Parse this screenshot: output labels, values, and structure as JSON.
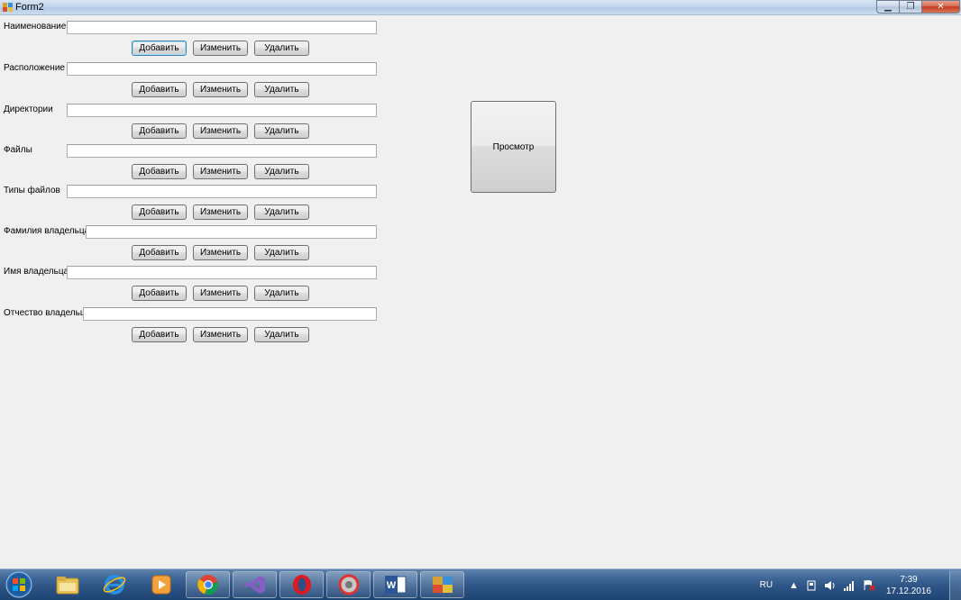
{
  "window": {
    "title": "Form2",
    "min_glyph": "▁",
    "max_glyph": "❐",
    "close_glyph": "✕"
  },
  "form": {
    "rows": [
      {
        "label": "Наименование",
        "value": "",
        "add": "Добавить",
        "edit": "Изменить",
        "delete": "Удалить"
      },
      {
        "label": "Расположение",
        "value": "",
        "add": "Добавить",
        "edit": "Изменить",
        "delete": "Удалить"
      },
      {
        "label": "Директории",
        "value": "",
        "add": "Добавить",
        "edit": "Изменить",
        "delete": "Удалить"
      },
      {
        "label": "Файлы",
        "value": "",
        "add": "Добавить",
        "edit": "Изменить",
        "delete": "Удалить"
      },
      {
        "label": "Типы файлов",
        "value": "",
        "add": "Добавить",
        "edit": "Изменить",
        "delete": "Удалить"
      },
      {
        "label": "Фамилия владельца",
        "value": "",
        "add": "Добавить",
        "edit": "Изменить",
        "delete": "Удалить"
      },
      {
        "label": "Имя владельца",
        "value": "",
        "add": "Добавить",
        "edit": "Изменить",
        "delete": "Удалить"
      },
      {
        "label": "Отчество владельца",
        "value": "",
        "add": "Добавить",
        "edit": "Изменить",
        "delete": "Удалить"
      }
    ],
    "view_button": "Просмотр"
  },
  "taskbar": {
    "apps": [
      {
        "name": "explorer-icon"
      },
      {
        "name": "internet-explorer-icon"
      },
      {
        "name": "media-player-icon"
      },
      {
        "name": "chrome-icon"
      },
      {
        "name": "visual-studio-icon"
      },
      {
        "name": "opera-icon"
      },
      {
        "name": "app-icon"
      },
      {
        "name": "word-icon"
      },
      {
        "name": "form-app-icon"
      }
    ],
    "tray": {
      "lang": "RU",
      "time": "7:39",
      "date": "17.12.2016"
    }
  },
  "colors": {
    "accent": "#3c7fb1",
    "taskbar": "#2c5283"
  }
}
